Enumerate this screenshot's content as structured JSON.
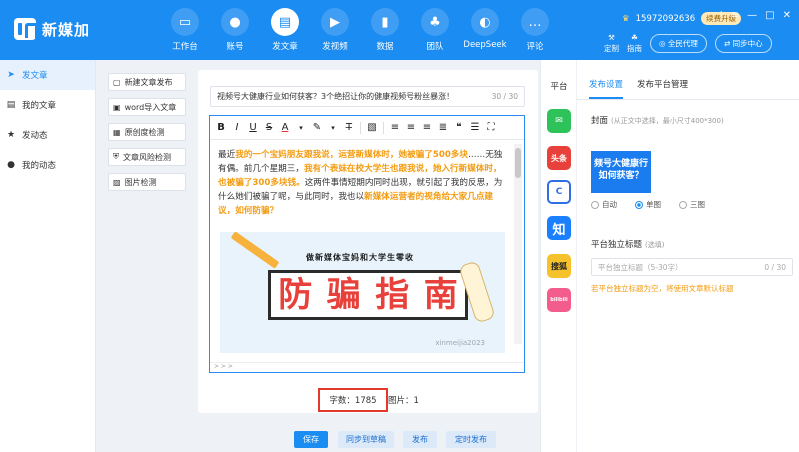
{
  "app": {
    "name": "新媒加"
  },
  "nav": [
    {
      "label": "工作台",
      "icon": "monitor-icon"
    },
    {
      "label": "账号",
      "icon": "user-icon"
    },
    {
      "label": "发文章",
      "icon": "document-icon"
    },
    {
      "label": "发视频",
      "icon": "video-icon"
    },
    {
      "label": "数据",
      "icon": "chart-icon"
    },
    {
      "label": "团队",
      "icon": "team-icon"
    },
    {
      "label": "DeepSeek",
      "icon": "deepseek-icon"
    },
    {
      "label": "评论",
      "icon": "comment-icon"
    }
  ],
  "account": {
    "phone": "15972092636",
    "vip": "续费升级"
  },
  "tools": {
    "customize": "定制",
    "guide": "指南",
    "agent": "全民代理",
    "sync": "同步中心"
  },
  "sidebar": [
    {
      "label": "发文章",
      "icon": "send-icon"
    },
    {
      "label": "我的文章",
      "icon": "list-icon"
    },
    {
      "label": "发动态",
      "icon": "star-icon"
    },
    {
      "label": "我的动态",
      "icon": "circle-icon"
    }
  ],
  "toolpanel": [
    {
      "label": "新建文章发布",
      "icon": "new-doc-icon"
    },
    {
      "label": "word导入文章",
      "icon": "word-icon"
    },
    {
      "label": "原创度检测",
      "icon": "original-check-icon"
    },
    {
      "label": "文章风险检测",
      "icon": "shield-icon"
    },
    {
      "label": "图片检测",
      "icon": "image-icon"
    }
  ],
  "editor": {
    "title": "视频号大健康行业如何获客？3个绝招让你的健康视频号粉丝暴涨！",
    "title_count": "30 / 30",
    "content": {
      "p1": "最近",
      "h1": "我的一个宝妈朋友跟我说，运营新媒体时，她被骗了500多块",
      "p2": "……无独有偶。前几个星期三，",
      "h2": "我有个表妹在校大学生也跟我说，她入行新媒体时，也被骗了300多块钱。",
      "p3": "这两件事情短期内同时出现，就引起了我的反思，为什么她们被骗了呢，与此同时，我也以",
      "h3": "新媒体运营者的视角给大家几点建议，如何防骗？"
    },
    "banner": {
      "subtitle": "做新媒体宝妈和大学生零收",
      "c1": "防",
      "c2": "骗",
      "c3": "指",
      "c4": "南",
      "watermark": "xinmeijia2023"
    },
    "word_count": "字数：1785",
    "image_count": "图片：1",
    "footer": "> > >"
  },
  "platforms": {
    "header": "平台",
    "items": [
      {
        "name": "wechat",
        "label": "",
        "color": "#2ec25b"
      },
      {
        "name": "toutiao",
        "label": "头条",
        "color": "#e8413b"
      },
      {
        "name": "baijiahao",
        "label": "",
        "color": "#ffffff"
      },
      {
        "name": "zhihu",
        "label": "知",
        "color": "#1a80ff"
      },
      {
        "name": "sohu",
        "label": "搜狐",
        "color": "#f6c22b"
      },
      {
        "name": "bilibili",
        "label": "bilibili",
        "color": "#f25d8e"
      }
    ]
  },
  "settings": {
    "tab_active": "发布设置",
    "tab_other": "发布平台管理",
    "cover_label": "封面",
    "cover_hint": "(从正文中选择，最小尺寸400*300)",
    "radio_auto": "自动",
    "radio_single": "单图",
    "radio_triple": "三图",
    "cover_text": "频号大健康行 如何获客？",
    "subtitle_label": "平台独立标题",
    "subtitle_optional": "(选填)",
    "subtitle_placeholder": "平台独立标题（5-30字）",
    "subtitle_count": "0 / 30",
    "subtitle_hint": "若平台独立标题为空，将使用文章默认标题"
  },
  "actions": {
    "save": "保存",
    "sync_draft": "同步到草稿",
    "publish": "发布",
    "schedule": "定时发布"
  }
}
